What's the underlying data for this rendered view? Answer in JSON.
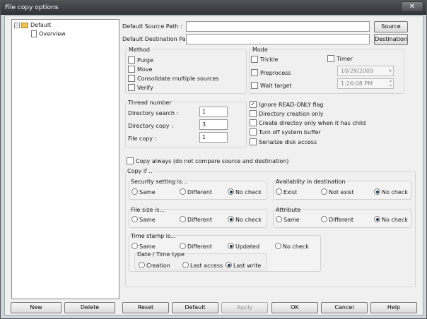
{
  "window": {
    "title": "File copy options",
    "close_icon": "✕"
  },
  "tree": {
    "root": "Default",
    "child": "Overview"
  },
  "paths": {
    "source_label": "Default Source Path :",
    "source_value": "",
    "source_button": "Source",
    "dest_label": "Default Destination Path :",
    "dest_value": "",
    "dest_button": "Destination"
  },
  "method": {
    "title": "Method",
    "purge": "Purge",
    "move": "Move",
    "consolidate": "Consolidate multiple sources",
    "verify": "Verify"
  },
  "mode": {
    "title": "Mode",
    "trickle": "Trickle",
    "timer": "Timer",
    "preprocess": "Preprocess",
    "wait_target": "Wait target",
    "date": "10/28/2009",
    "time": "1:26:08 PM"
  },
  "thread": {
    "title": "Thread number",
    "dir_search_label": "Directory search :",
    "dir_search": "1",
    "dir_copy_label": "Directory copy :",
    "dir_copy": "3",
    "file_copy_label": "File copy :",
    "file_copy": "1"
  },
  "flags": {
    "ignore_readonly": "Ignore READ-ONLY flag",
    "dir_creation_only": "Directory creation only",
    "create_dir_child": "Create directoy only when it has child",
    "turn_off_buffer": "Turn off system buffer",
    "serialize": "Serialize disk access"
  },
  "copy_always": "Copy always (do not compare source and destination)",
  "copyif": {
    "title": "Copy if ..",
    "security": {
      "title": "Security setting is...",
      "opts": [
        "Same",
        "Different",
        "No check"
      ],
      "selected": 2
    },
    "availability": {
      "title": "Availablity in destination",
      "opts": [
        "Exist",
        "Not exist",
        "No check"
      ],
      "selected": 2
    },
    "filesize": {
      "title": "File size is...",
      "opts": [
        "Same",
        "Different",
        "No check"
      ],
      "selected": 2
    },
    "attribute": {
      "title": "Attribute",
      "opts": [
        "Same",
        "Different",
        "No check"
      ],
      "selected": 2
    },
    "timestamp": {
      "title": "Time stamp is...",
      "opts": [
        "Same",
        "Different",
        "Updated",
        "No check"
      ],
      "selected": 2
    },
    "datetime": {
      "title": "Date / Time type",
      "opts": [
        "Creation",
        "Last access",
        "Last write"
      ],
      "selected": 2
    }
  },
  "buttons": {
    "new": "New",
    "delete": "Delete",
    "reset": "Reset",
    "default": "Default",
    "apply": "Apply",
    "ok": "OK",
    "cancel": "Cancel",
    "help": "Help"
  }
}
